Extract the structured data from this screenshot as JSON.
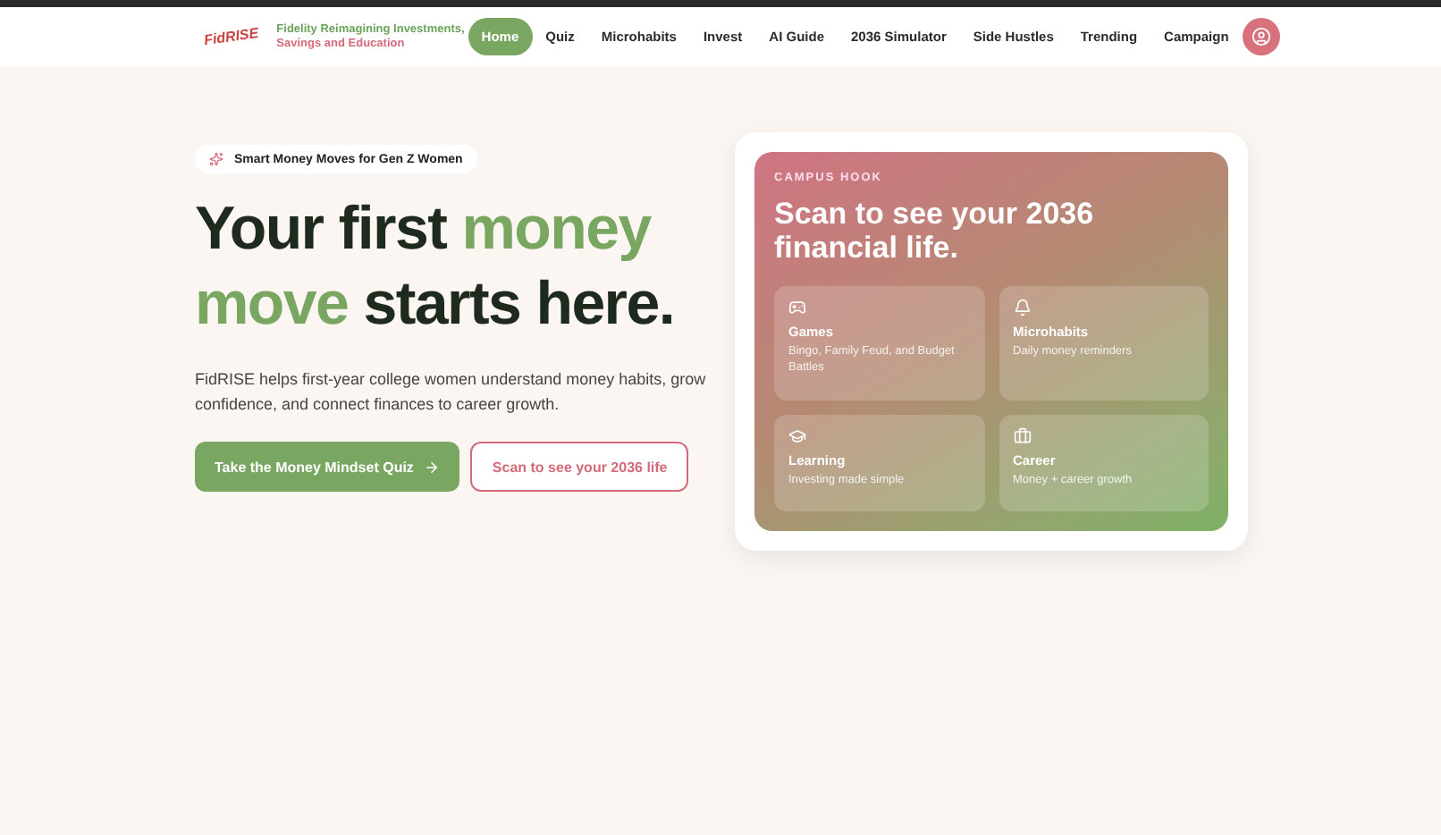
{
  "header": {
    "logo": "FidRISE",
    "tagline_lines": [
      {
        "text": "Fidelity Reimagining Investments,",
        "color": "#6aa35a"
      },
      {
        "text": "Savings and Education",
        "color": "#d46a7a"
      }
    ],
    "nav": [
      {
        "label": "Home",
        "selected": true
      },
      {
        "label": "Quiz",
        "selected": false
      },
      {
        "label": "Microhabits",
        "selected": false
      },
      {
        "label": "Invest",
        "selected": false
      },
      {
        "label": "AI Guide",
        "selected": false
      },
      {
        "label": "2036 Simulator",
        "selected": false
      },
      {
        "label": "Side Hustles",
        "selected": false
      },
      {
        "label": "Trending",
        "selected": false
      },
      {
        "label": "Campaign",
        "selected": false
      }
    ]
  },
  "hero": {
    "badge": "Smart Money Moves for Gen Z Women",
    "headline": [
      {
        "text": "Your first ",
        "accent": false
      },
      {
        "text": "money",
        "accent": true
      },
      {
        "text": "move",
        "accent": true
      },
      {
        "text": " starts here.",
        "accent": false
      }
    ],
    "description": "FidRISE helps first-year college women understand money habits, grow confidence, and connect finances to career growth.",
    "primary_button": "Take the Money Mindset Quiz",
    "secondary_button": "Scan to see your 2036 life"
  },
  "card": {
    "eyebrow": "CAMPUS HOOK",
    "title": "Scan to see your 2036 financial life.",
    "tiles": [
      {
        "kind": "games",
        "title": "Games",
        "text": "Bingo, Family Feud, and Budget Battles"
      },
      {
        "kind": "bell",
        "title": "Microhabits",
        "text": "Daily money reminders"
      },
      {
        "kind": "cap",
        "title": "Learning",
        "text": "Investing made simple"
      },
      {
        "kind": "briefcase",
        "title": "Career",
        "text": "Money + career growth"
      }
    ]
  }
}
